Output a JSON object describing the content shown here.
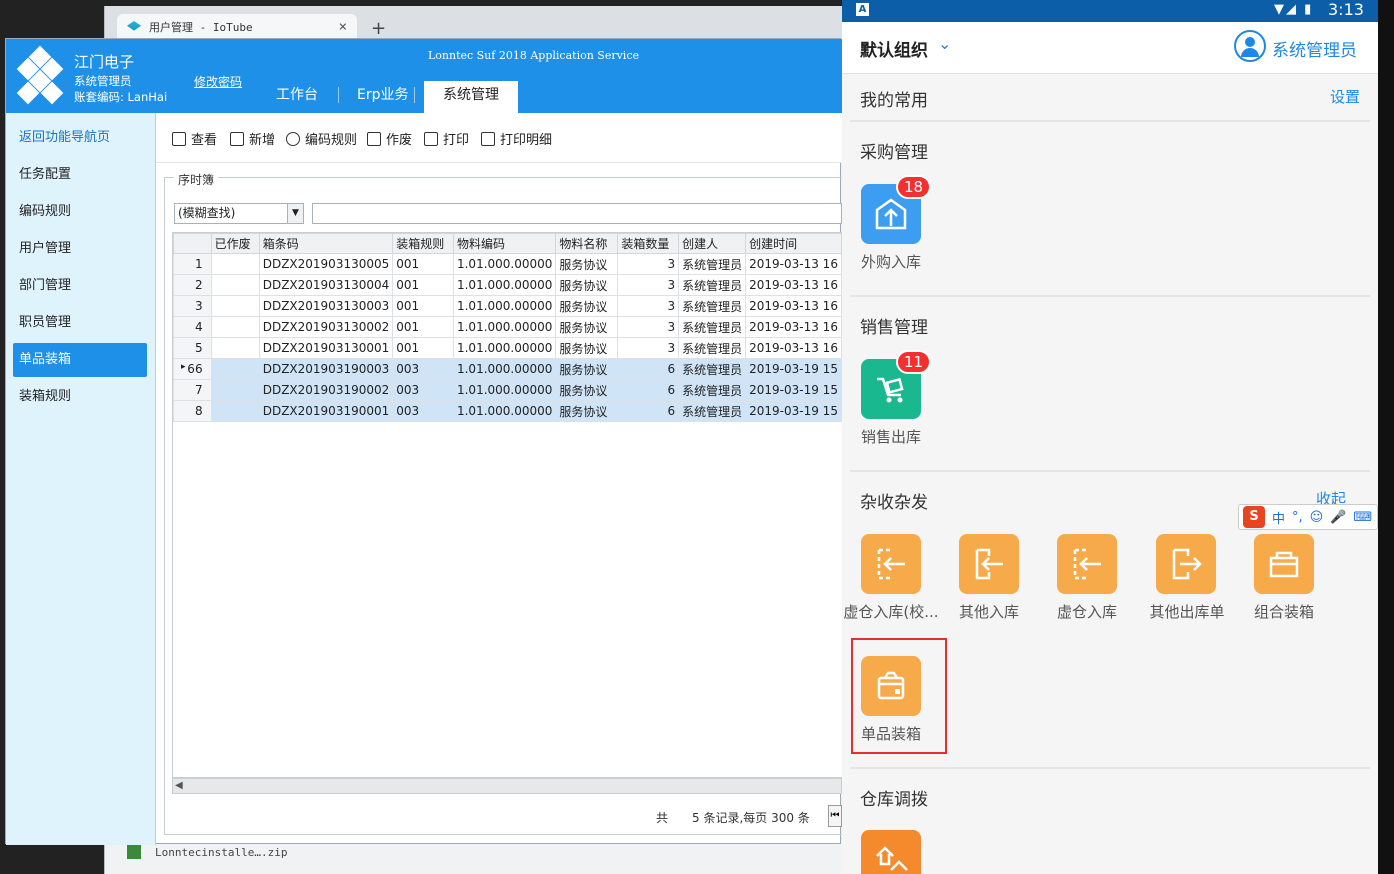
{
  "browser": {
    "tab_title": "用户管理 - IoTube",
    "close_glyph": "×",
    "new_tab_glyph": "+",
    "download_file": "Lonntecinstalle….zip"
  },
  "app": {
    "company": "江门电子",
    "role": "系统管理员",
    "account": "账套编码: LanHai",
    "change_password": "修改密码",
    "service_title": "Lonntec Suf 2018 Application Service",
    "nav_tabs": [
      "工作台",
      "Erp业务",
      "系统管理"
    ]
  },
  "sidebar": {
    "back_label": "返回功能导航页",
    "items": [
      "任务配置",
      "编码规则",
      "用户管理",
      "部门管理",
      "职员管理",
      "单品装箱",
      "装箱规则"
    ]
  },
  "toolbar": {
    "buttons": [
      "查看",
      "新增",
      "编码规则",
      "作废",
      "打印",
      "打印明细"
    ]
  },
  "filter": {
    "group_label": "序时簿",
    "select_value": "(模糊查找)"
  },
  "grid": {
    "columns": [
      "已作废",
      "箱条码",
      "装箱规则",
      "物料编码",
      "物料名称",
      "装箱数量",
      "创建人",
      "创建时间"
    ],
    "rows": [
      [
        "1",
        "",
        "DDZX201903130005",
        "001",
        "1.01.000.00000",
        "服务协议",
        "3",
        "系统管理员",
        "2019-03-13 16"
      ],
      [
        "2",
        "",
        "DDZX201903130004",
        "001",
        "1.01.000.00000",
        "服务协议",
        "3",
        "系统管理员",
        "2019-03-13 16"
      ],
      [
        "3",
        "",
        "DDZX201903130003",
        "001",
        "1.01.000.00000",
        "服务协议",
        "3",
        "系统管理员",
        "2019-03-13 16"
      ],
      [
        "4",
        "",
        "DDZX201903130002",
        "001",
        "1.01.000.00000",
        "服务协议",
        "3",
        "系统管理员",
        "2019-03-13 16"
      ],
      [
        "5",
        "",
        "DDZX201903130001",
        "001",
        "1.01.000.00000",
        "服务协议",
        "3",
        "系统管理员",
        "2019-03-13 16"
      ],
      [
        "6",
        "",
        "DDZX201903190003",
        "003",
        "1.01.000.00000",
        "服务协议",
        "6",
        "系统管理员",
        "2019-03-19 15"
      ],
      [
        "7",
        "",
        "DDZX201903190002",
        "003",
        "1.01.000.00000",
        "服务协议",
        "6",
        "系统管理员",
        "2019-03-19 15"
      ],
      [
        "8",
        "",
        "DDZX201903190001",
        "003",
        "1.01.000.00000",
        "服务协议",
        "6",
        "系统管理员",
        "2019-03-19 15"
      ]
    ],
    "selected_rows": [
      6,
      7,
      8
    ],
    "current_row_marker": "▸"
  },
  "pager": {
    "prefix": "共",
    "summary": "5 条记录,每页 300 条"
  },
  "phone": {
    "status": {
      "time": "3:13",
      "a_icon": "A",
      "signal_icons": "▼◢ ▮"
    },
    "org_label": "默认组织",
    "chevron": "⌄",
    "admin_name": "系统管理员",
    "favorites": {
      "title": "我的常用",
      "settings": "设置"
    },
    "sections": {
      "purchase": {
        "title": "采购管理",
        "apps": [
          {
            "label": "外购入库",
            "badge": "18",
            "icon": "warehouse-in-icon"
          }
        ]
      },
      "sales": {
        "title": "销售管理",
        "apps": [
          {
            "label": "销售出库",
            "badge": "11",
            "icon": "cart-out-icon"
          }
        ]
      },
      "misc": {
        "title": "杂收杂发",
        "collapse": "收起",
        "apps": [
          {
            "label": "虚仓入库(校...",
            "icon": "virtual-in-icon"
          },
          {
            "label": "其他入库",
            "icon": "other-in-icon"
          },
          {
            "label": "虚仓入库",
            "icon": "virtual-in-icon"
          },
          {
            "label": "其他出库单",
            "icon": "other-out-icon"
          },
          {
            "label": "组合装箱",
            "icon": "combo-box-icon"
          },
          {
            "label": "单品装箱",
            "icon": "single-box-icon"
          }
        ]
      },
      "transfer": {
        "title": "仓库调拨"
      }
    },
    "ime": {
      "logo": "S",
      "mode": "中",
      "punct": "°,",
      "smile": "☺",
      "mic": "🎤",
      "keyboard": "⌨"
    }
  },
  "colors": {
    "app_blue": "#1e90e8",
    "phone_status": "#0d5ea8",
    "accent_blue": "#1e88e5",
    "badge_red": "#f23030",
    "orange": "#f6aa4a",
    "highlight_red": "#e03030"
  }
}
